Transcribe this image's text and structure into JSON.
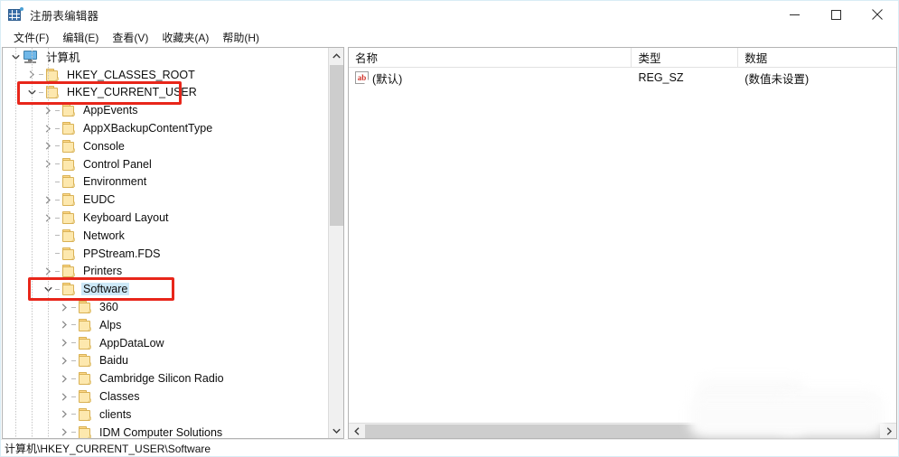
{
  "window": {
    "title": "注册表编辑器",
    "icon": "registry-editor-icon",
    "controls": {
      "minimize": "最小化",
      "maximize": "最大化",
      "close": "关闭"
    }
  },
  "menubar": {
    "items": [
      {
        "label": "文件(F)",
        "name": "menu-file"
      },
      {
        "label": "编辑(E)",
        "name": "menu-edit"
      },
      {
        "label": "查看(V)",
        "name": "menu-view"
      },
      {
        "label": "收藏夹(A)",
        "name": "menu-favorites"
      },
      {
        "label": "帮助(H)",
        "name": "menu-help"
      }
    ]
  },
  "tree": {
    "items": [
      {
        "label": "计算机",
        "depth": 0,
        "expanded": true,
        "icon": "computer-icon",
        "selected": false
      },
      {
        "label": "HKEY_CLASSES_ROOT",
        "depth": 1,
        "expanded": false,
        "icon": "folder-icon",
        "selected": false
      },
      {
        "label": "HKEY_CURRENT_USER",
        "depth": 1,
        "expanded": true,
        "icon": "folder-icon",
        "selected": false
      },
      {
        "label": "AppEvents",
        "depth": 2,
        "expanded": false,
        "icon": "folder-icon",
        "selected": false
      },
      {
        "label": "AppXBackupContentType",
        "depth": 2,
        "expanded": false,
        "icon": "folder-icon",
        "selected": false
      },
      {
        "label": "Console",
        "depth": 2,
        "expanded": false,
        "icon": "folder-icon",
        "selected": false
      },
      {
        "label": "Control Panel",
        "depth": 2,
        "expanded": false,
        "icon": "folder-icon",
        "selected": false
      },
      {
        "label": "Environment",
        "depth": 2,
        "expanded": null,
        "icon": "folder-icon",
        "selected": false
      },
      {
        "label": "EUDC",
        "depth": 2,
        "expanded": false,
        "icon": "folder-icon",
        "selected": false
      },
      {
        "label": "Keyboard Layout",
        "depth": 2,
        "expanded": false,
        "icon": "folder-icon",
        "selected": false
      },
      {
        "label": "Network",
        "depth": 2,
        "expanded": null,
        "icon": "folder-icon",
        "selected": false
      },
      {
        "label": "PPStream.FDS",
        "depth": 2,
        "expanded": null,
        "icon": "folder-icon",
        "selected": false
      },
      {
        "label": "Printers",
        "depth": 2,
        "expanded": false,
        "icon": "folder-icon",
        "selected": false
      },
      {
        "label": "Software",
        "depth": 2,
        "expanded": true,
        "icon": "folder-icon",
        "selected": true
      },
      {
        "label": "360",
        "depth": 3,
        "expanded": false,
        "icon": "folder-icon",
        "selected": false
      },
      {
        "label": "Alps",
        "depth": 3,
        "expanded": false,
        "icon": "folder-icon",
        "selected": false
      },
      {
        "label": "AppDataLow",
        "depth": 3,
        "expanded": false,
        "icon": "folder-icon",
        "selected": false
      },
      {
        "label": "Baidu",
        "depth": 3,
        "expanded": false,
        "icon": "folder-icon",
        "selected": false
      },
      {
        "label": "Cambridge Silicon Radio",
        "depth": 3,
        "expanded": false,
        "icon": "folder-icon",
        "selected": false
      },
      {
        "label": "Classes",
        "depth": 3,
        "expanded": false,
        "icon": "folder-icon",
        "selected": false
      },
      {
        "label": "clients",
        "depth": 3,
        "expanded": false,
        "icon": "folder-icon",
        "selected": false
      },
      {
        "label": "IDM Computer Solutions",
        "depth": 3,
        "expanded": false,
        "icon": "folder-icon",
        "selected": false
      }
    ]
  },
  "list": {
    "columns": [
      {
        "label": "名称",
        "name": "column-name"
      },
      {
        "label": "类型",
        "name": "column-type"
      },
      {
        "label": "数据",
        "name": "column-data"
      }
    ],
    "rows": [
      {
        "name": "(默认)",
        "type": "REG_SZ",
        "data": "(数值未设置)",
        "icon": "ab-string-icon"
      }
    ]
  },
  "statusbar": {
    "path": "计算机\\HKEY_CURRENT_USER\\Software"
  },
  "annotations": {
    "accent_color": "#e8261a",
    "boxes": [
      {
        "name": "highlight-hkey-current-user",
        "target": "HKEY_CURRENT_USER"
      },
      {
        "name": "highlight-software",
        "target": "Software"
      }
    ]
  }
}
